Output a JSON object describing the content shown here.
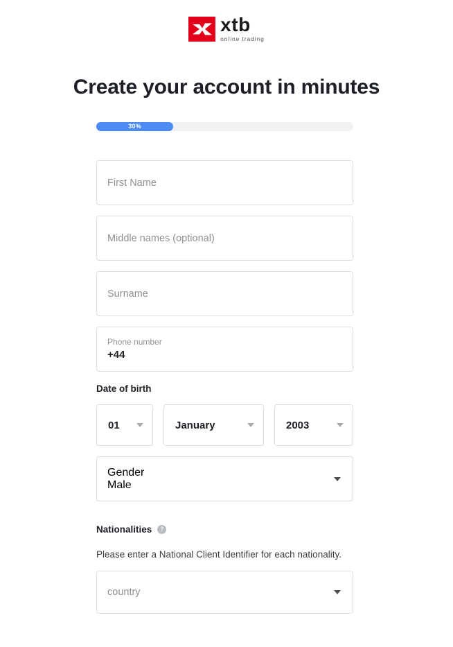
{
  "brand": {
    "logo_word": "xtb",
    "logo_tagline": "online trading",
    "logo_color": "#e2001a"
  },
  "heading": "Create your account in minutes",
  "progress": {
    "label": "30%",
    "percent": 30,
    "fill_color": "#4c8bf5",
    "track_color": "#f0f1f3"
  },
  "form": {
    "first_name": {
      "placeholder": "First Name",
      "value": ""
    },
    "middle_names": {
      "placeholder": "Middle names (optional)",
      "value": ""
    },
    "surname": {
      "placeholder": "Surname",
      "value": ""
    },
    "phone": {
      "label": "Phone number",
      "value": "+44"
    },
    "date_of_birth": {
      "section_label": "Date of birth",
      "day": "01",
      "month": "January",
      "year": "2003"
    },
    "gender": {
      "label": "Gender",
      "value": "Male"
    },
    "nationalities": {
      "title": "Nationalities",
      "help_icon": "question-mark-icon",
      "help_glyph": "?",
      "description": "Please enter a National Client Identifier for each nationality.",
      "country": {
        "placeholder": "country",
        "value": ""
      }
    }
  },
  "icons": {
    "caret_down": "chevron-down-icon"
  }
}
